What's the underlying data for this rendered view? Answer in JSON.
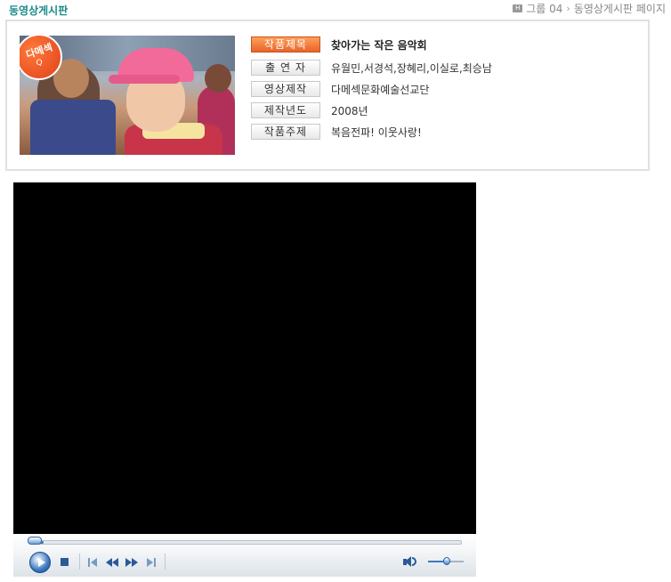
{
  "header": {
    "board_title": "동영상게시판",
    "breadcrumb": [
      "그룹 04",
      "동영상게시판 페이지"
    ]
  },
  "info": {
    "badge_text": "다메섹",
    "badge_sub": "Q",
    "rows": [
      {
        "label": "작품제목",
        "value": "찾아가는 작은 음악회",
        "active": true
      },
      {
        "label": "출 연 자",
        "value": "유월민,서경석,장혜리,이실로,최승남",
        "active": false
      },
      {
        "label": "영상제작",
        "value": "다메섹문화예술선교단",
        "active": false
      },
      {
        "label": "제작년도",
        "value": "2008년",
        "active": false
      },
      {
        "label": "작품주제",
        "value": "복음전파! 이웃사랑!",
        "active": false
      }
    ]
  },
  "player": {
    "progress": 0.03,
    "volume": 0.6,
    "icons": [
      "play-icon",
      "stop-icon",
      "previous-icon",
      "rewind-icon",
      "fast-forward-icon",
      "next-icon",
      "volume-icon"
    ],
    "accent_color": "#3a7ac0"
  },
  "colors": {
    "title": "#1a8a8a",
    "active_label": "#e8642a"
  }
}
